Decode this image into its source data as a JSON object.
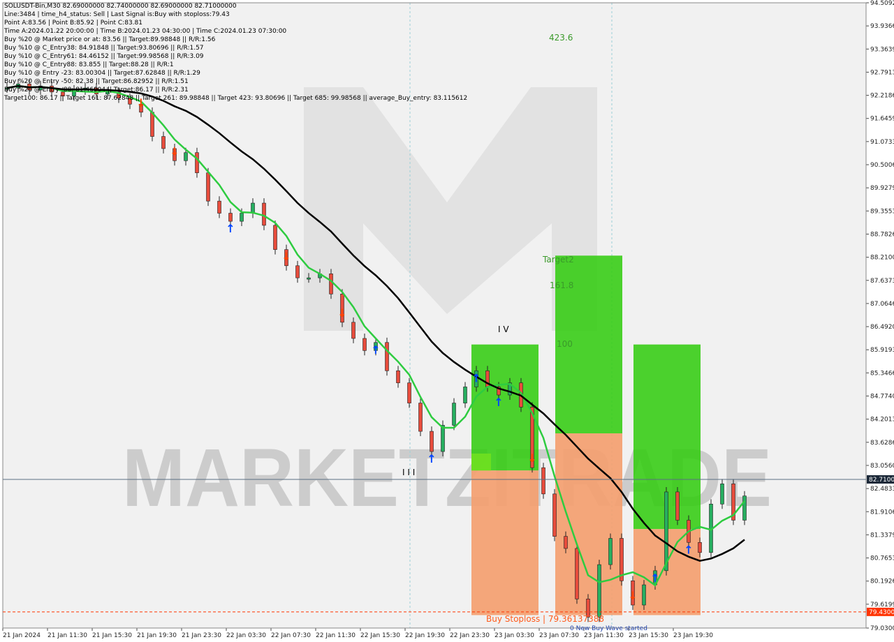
{
  "chart_data": {
    "type": "candlestick",
    "symbol_line": "SOLUSDT-Bin,M30  82.69000000 82.74000000 82.69000000 82.71000000",
    "info_lines": [
      "Line:3484 | time_h4_status: Sell | Last Signal is:Buy with stoploss:79.43",
      "Point A:83.56 | Point B:85.92 | Point C:83.81",
      "Time A:2024.01.22 20:00:00 | Time B:2024.01.23 04:30:00 | Time C:2024.01.23 07:30:00",
      "Buy %20 @ Market price or at: 83.56 || Target:89.98848 || R/R:1.56",
      "Buy %10 @ C_Entry38: 84.91848 || Target:93.80696 || R/R:1.57",
      "Buy %10 @ C_Entry61: 84.46152 || Target:99.98568 || R/R:3.09",
      "Buy %10 @ C_Entry88: 83.855 || Target:88.28 || R/R:1",
      "Buy %10 @ Entry -23: 83.00304 || Target:87.62848 || R/R:1.29",
      "Buy %20 @ Entry -50: 82.38 || Target:86.82952 || R/R:1.51",
      "Buy %20 @ Entry -88: 81.46904 || Target:86.17 || R/R:2.31",
      "Target100: 86.17 || Target 161: 87.62848 || Target 261: 89.98848 || Target 423: 93.80696 || Target 685: 99.98568 || average_Buy_entry: 83.115612"
    ],
    "y_ticks": [
      "94.5092",
      "93.9366",
      "93.3639",
      "92.7913",
      "92.2186",
      "91.6459",
      "91.0733",
      "90.5006",
      "89.9279",
      "89.3553",
      "88.7826",
      "88.2100",
      "87.6373",
      "87.0646",
      "86.4920",
      "85.9193",
      "85.3466",
      "84.7740",
      "84.2013",
      "83.6286",
      "83.0560",
      "82.4833",
      "81.9106",
      "81.3379",
      "80.7653",
      "80.1926",
      "79.6199",
      "79.0300"
    ],
    "x_ticks": [
      "21 Jan 2024",
      "21 Jan 11:30",
      "21 Jan 15:30",
      "21 Jan 19:30",
      "21 Jan 23:30",
      "22 Jan 03:30",
      "22 Jan 07:30",
      "22 Jan 11:30",
      "22 Jan 15:30",
      "22 Jan 19:30",
      "22 Jan 23:30",
      "23 Jan 03:30",
      "23 Jan 07:30",
      "23 Jan 11:30",
      "23 Jan 15:30",
      "23 Jan 19:30"
    ],
    "current_price": "82.7100",
    "stoploss_price": "79.4300",
    "stoploss_label": "Buy Stoploss | 79.36137388",
    "watermark": "MARKETZITRADE",
    "annotations": {
      "target_423": "423.6",
      "target2": "Target2",
      "target_161": "161.8",
      "target_100": "100",
      "wave_iii": "I I I",
      "wave_iv": "I V",
      "new_buy": "0 New Buy Wave started"
    },
    "colors": {
      "ma_fast": "#2ecc40",
      "ma_slow": "#000000",
      "green_zone": "#33cc11",
      "orange_zone": "#f4a070",
      "stoploss_line": "#ff3300",
      "price_line": "#5a6e82",
      "buy_arrow": "#0044ff",
      "sell_arrow": "#ff4400"
    },
    "closes": [
      92.4,
      92.5,
      92.35,
      92.45,
      92.3,
      92.2,
      92.35,
      92.4,
      92.25,
      92.3,
      92.15,
      92.0,
      91.8,
      91.2,
      90.9,
      90.6,
      90.8,
      90.3,
      89.6,
      89.3,
      89.1,
      89.3,
      89.55,
      89.0,
      88.4,
      88.0,
      87.7,
      87.7,
      87.8,
      87.3,
      86.6,
      86.2,
      85.9,
      86.1,
      85.4,
      85.1,
      84.6,
      83.9,
      83.4,
      84.05,
      84.6,
      85.0,
      85.4,
      85.0,
      84.8,
      85.1,
      84.5,
      83.0,
      82.35,
      81.3,
      81.0,
      79.75,
      79.3,
      80.6,
      81.25,
      80.2,
      79.6,
      80.1,
      80.45,
      82.4,
      81.7,
      81.15,
      80.9,
      82.1,
      82.6,
      81.7,
      82.3
    ]
  }
}
